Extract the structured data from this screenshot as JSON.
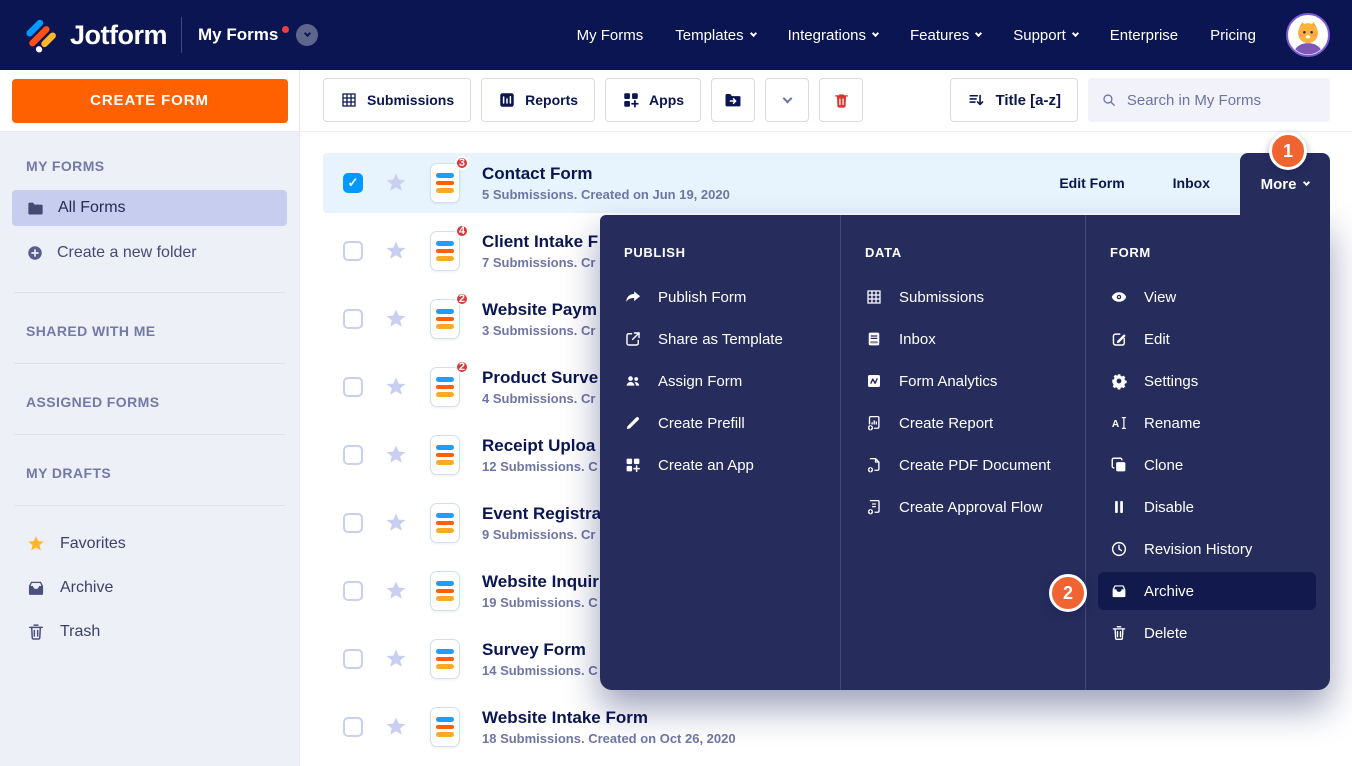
{
  "navbar": {
    "brand": "Jotform",
    "workspace": {
      "label": "My Forms",
      "has_notification_dot": true
    },
    "links": [
      {
        "label": "My Forms"
      },
      {
        "label": "Templates",
        "caret": true
      },
      {
        "label": "Integrations",
        "caret": true
      },
      {
        "label": "Features",
        "caret": true
      },
      {
        "label": "Support",
        "caret": true
      },
      {
        "label": "Enterprise"
      },
      {
        "label": "Pricing"
      }
    ]
  },
  "sidebar": {
    "create_button": "CREATE FORM",
    "my_forms_header": "MY FORMS",
    "all_forms_label": "All Forms",
    "create_folder_label": "Create a new folder",
    "shared_header": "SHARED WITH ME",
    "assigned_header": "ASSIGNED FORMS",
    "drafts_header": "MY DRAFTS",
    "bottom_items": [
      {
        "label": "Favorites",
        "icon": "star"
      },
      {
        "label": "Archive",
        "icon": "archive"
      },
      {
        "label": "Trash",
        "icon": "trash"
      }
    ]
  },
  "toolbar": {
    "submissions_label": "Submissions",
    "reports_label": "Reports",
    "apps_label": "Apps",
    "sort_label": "Title [a-z]",
    "search_placeholder": "Search in My Forms"
  },
  "list": {
    "rows": [
      {
        "title": "Contact Form",
        "subtitle": "5 Submissions. Created on Jun 19, 2020",
        "badge": "3",
        "selected": true,
        "checked": true,
        "edit_label": "Edit Form",
        "inbox_label": "Inbox"
      },
      {
        "title": "Client Intake F",
        "subtitle": "7 Submissions. Cr",
        "badge": "4"
      },
      {
        "title": "Website Paym",
        "subtitle": "3 Submissions. Cr",
        "badge": "2"
      },
      {
        "title": "Product Surve",
        "subtitle": "4 Submissions. Cr",
        "badge": "2"
      },
      {
        "title": "Receipt Uploa",
        "subtitle": "12 Submissions. C"
      },
      {
        "title": "Event Registra",
        "subtitle": "9 Submissions. Cr"
      },
      {
        "title": "Website Inquir",
        "subtitle": "19 Submissions. C"
      },
      {
        "title": "Survey Form",
        "subtitle": "14 Submissions. C"
      },
      {
        "title": "Website Intake Form",
        "subtitle": "18 Submissions. Created on Oct 26, 2020"
      }
    ]
  },
  "menu": {
    "more_label": "More",
    "columns": [
      {
        "title": "PUBLISH",
        "items": [
          {
            "label": "Publish Form",
            "icon": "share"
          },
          {
            "label": "Share as Template",
            "icon": "export"
          },
          {
            "label": "Assign Form",
            "icon": "users"
          },
          {
            "label": "Create Prefill",
            "icon": "pencil"
          },
          {
            "label": "Create an App",
            "icon": "app-plus"
          }
        ]
      },
      {
        "title": "DATA",
        "items": [
          {
            "label": "Submissions",
            "icon": "grid"
          },
          {
            "label": "Inbox",
            "icon": "inbox"
          },
          {
            "label": "Form Analytics",
            "icon": "analytics"
          },
          {
            "label": "Create Report",
            "icon": "report-plus"
          },
          {
            "label": "Create PDF Document",
            "icon": "pdf-plus"
          },
          {
            "label": "Create Approval Flow",
            "icon": "flow-plus"
          }
        ]
      },
      {
        "title": "FORM",
        "items": [
          {
            "label": "View",
            "icon": "eye"
          },
          {
            "label": "Edit",
            "icon": "edit-square"
          },
          {
            "label": "Settings",
            "icon": "gear"
          },
          {
            "label": "Rename",
            "icon": "rename"
          },
          {
            "label": "Clone",
            "icon": "clone"
          },
          {
            "label": "Disable",
            "icon": "pause"
          },
          {
            "label": "Revision History",
            "icon": "clock"
          },
          {
            "label": "Archive",
            "icon": "archive",
            "active": true
          },
          {
            "label": "Delete",
            "icon": "trash"
          }
        ]
      }
    ]
  },
  "callouts": {
    "step1": "1",
    "step2": "2"
  },
  "colors": {
    "navbar_navy": "#0a1551",
    "menu_navy": "#262d5d",
    "menu_active_navy": "#11194d",
    "orange": "#ff6100",
    "callout_orange": "#ef6430",
    "badge_red": "#d9363a",
    "selected_row_blue": "#e7f4fd",
    "checkbox_blue": "#0099ff",
    "sidebar_bg": "#eef0f8"
  }
}
